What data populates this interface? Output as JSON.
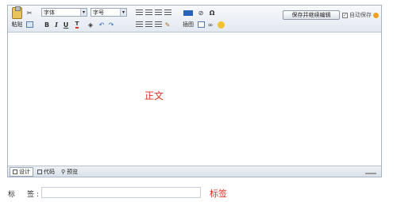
{
  "editor": {
    "paste_label": "粘贴",
    "font_select": "字体",
    "size_select": "字号",
    "format_bold": "B",
    "format_italic": "I",
    "format_underline": "U",
    "insert_image_label": "插图",
    "omega_symbol": "Ω",
    "save_button": "保存并继续编辑",
    "autosave_label": "自动保存",
    "autosave_checked": true,
    "body_text": "正文",
    "modes": [
      {
        "label": "设计",
        "icon": "design-mode-icon",
        "active": true
      },
      {
        "label": "代码",
        "icon": "code-mode-icon",
        "active": false
      },
      {
        "label": "预览",
        "icon": "preview-mode-icon",
        "active": false
      }
    ]
  },
  "tags": {
    "label": "标　签:",
    "value": "",
    "note": "标签"
  },
  "colors": {
    "accent_red": "#d9301f",
    "toolbar_border": "#a9b5c4"
  }
}
